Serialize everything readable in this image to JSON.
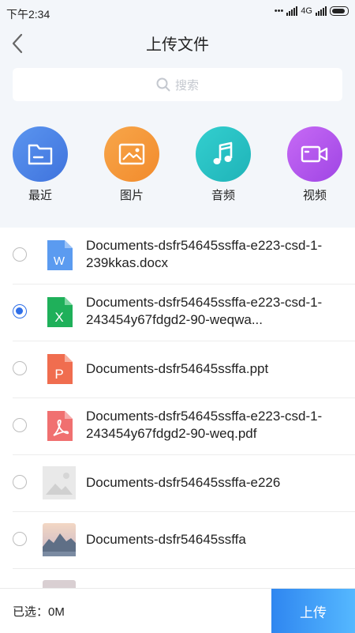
{
  "status_bar": {
    "time": "下午2:34",
    "network": "4G"
  },
  "header": {
    "title": "上传文件"
  },
  "search": {
    "placeholder": "搜索"
  },
  "categories": [
    {
      "label": "最近",
      "icon": "folder-icon",
      "color": "#4f86e8"
    },
    {
      "label": "图片",
      "icon": "image-icon",
      "color": "#f59a3a"
    },
    {
      "label": "音频",
      "icon": "music-icon",
      "color": "#26c2c4"
    },
    {
      "label": "视频",
      "icon": "video-icon",
      "color": "#b257ec"
    }
  ],
  "files": [
    {
      "name": "Documents-dsfr54645ssffa-e223-csd-1-239kkas.docx",
      "type": "word",
      "selected": false
    },
    {
      "name": "Documents-dsfr54645ssffa-e223-csd-1-243454y67fdgd2-90-weqwa...",
      "type": "excel",
      "selected": true
    },
    {
      "name": "Documents-dsfr54645ssffa.ppt",
      "type": "ppt",
      "selected": false
    },
    {
      "name": "Documents-dsfr54645ssffa-e223-csd-1-243454y67fdgd2-90-weq.pdf",
      "type": "pdf",
      "selected": false
    },
    {
      "name": "Documents-dsfr54645ssffa-e226",
      "type": "image-placeholder",
      "selected": false
    },
    {
      "name": "Documents-dsfr54645ssffa",
      "type": "photo",
      "selected": false
    },
    {
      "name": "",
      "type": "photo",
      "selected": false
    }
  ],
  "footer": {
    "selected_text": "已选：0M",
    "upload_label": "上传"
  }
}
